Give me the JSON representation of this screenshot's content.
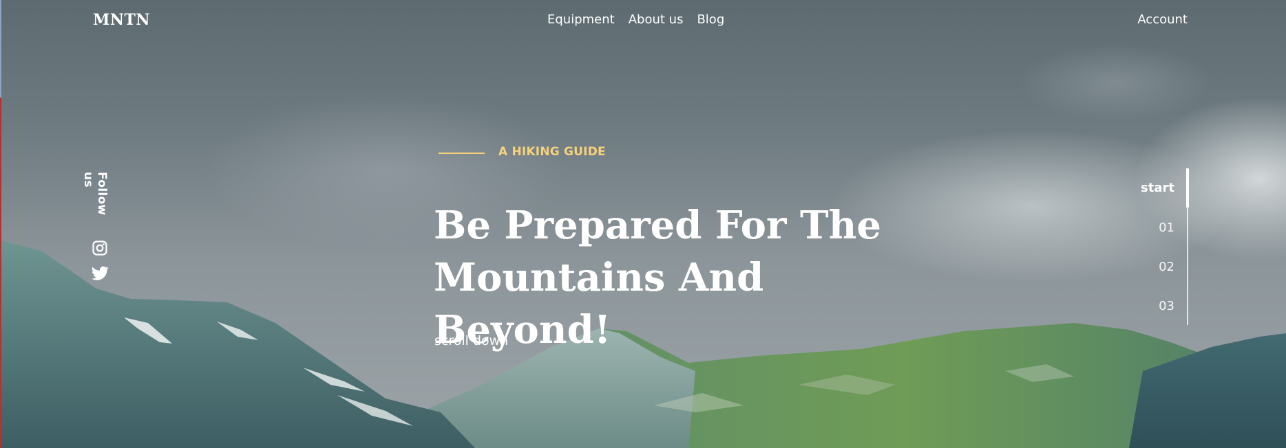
{
  "brand": {
    "logo": "MNTN"
  },
  "nav": {
    "items": [
      "Equipment",
      "About us",
      "Blog"
    ],
    "account": "Account"
  },
  "social": {
    "label": "Follow us",
    "icons": [
      "instagram-icon",
      "twitter-icon"
    ]
  },
  "hero": {
    "eyebrow": "A HIKING GUIDE",
    "title_line1": "Be Prepared For The",
    "title_line2": "Mountains And Beyond!",
    "scroll_label": "scroll down"
  },
  "pager": {
    "items": [
      "start",
      "01",
      "02",
      "03"
    ],
    "active_index": 0
  },
  "colors": {
    "accent": "#f6d27a",
    "text": "#ffffff"
  }
}
